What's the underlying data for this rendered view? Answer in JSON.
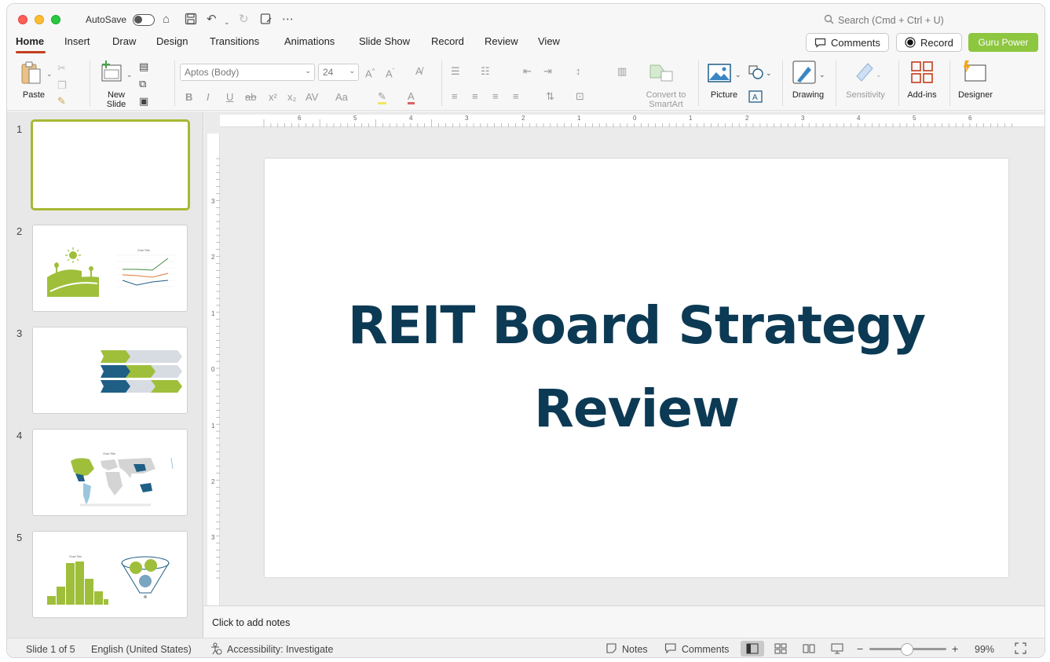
{
  "titlebar": {
    "autosave_label": "AutoSave",
    "search_placeholder": "Search (Cmd + Ctrl + U)"
  },
  "tabs": [
    "Home",
    "Insert",
    "Draw",
    "Design",
    "Transitions",
    "Animations",
    "Slide Show",
    "Record",
    "Review",
    "View"
  ],
  "header_buttons": {
    "comments": "Comments",
    "record": "Record",
    "guru": "Guru Power"
  },
  "ribbon": {
    "paste": "Paste",
    "new_slide": [
      "New",
      "Slide"
    ],
    "font_name": "Aptos (Body)",
    "font_size": "24",
    "convert_smartart": [
      "Convert to",
      "SmartArt"
    ],
    "picture": "Picture",
    "drawing": "Drawing",
    "sensitivity": "Sensitivity",
    "addins": "Add-ins",
    "designer": "Designer"
  },
  "slides": [
    "1",
    "2",
    "3",
    "4",
    "5"
  ],
  "slide": {
    "title_line1": "REIT Board Strategy",
    "title_line2": "Review"
  },
  "notes": {
    "placeholder": "Click to add notes"
  },
  "status": {
    "slide_info": "Slide 1 of 5",
    "language": "English (United States)",
    "accessibility": "Accessibility: Investigate",
    "notes": "Notes",
    "comments": "Comments",
    "zoom": "99%"
  },
  "ruler": {
    "h_ticks": [
      "6",
      "5",
      "4",
      "3",
      "2",
      "1",
      "0",
      "1",
      "2",
      "3",
      "4",
      "5",
      "6"
    ],
    "v_ticks": [
      "3",
      "2",
      "1",
      "0",
      "1",
      "2",
      "3"
    ]
  },
  "thumbnails": {
    "s2_chart_title": "Chart Title",
    "s4_chart_title": "Chart Title",
    "s5_chart_title": "Chart Title"
  },
  "colors": {
    "accent_red": "#c43e1c",
    "guru_green": "#8dc63f",
    "title_navy": "#0c3a54",
    "thumb_green": "#9fbf3b",
    "thumb_blue": "#1f5f86"
  }
}
